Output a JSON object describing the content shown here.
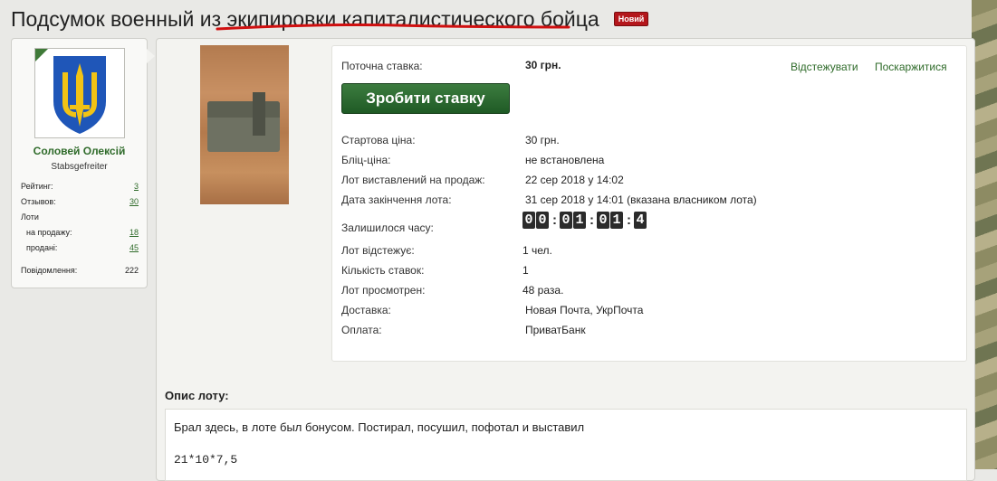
{
  "title": {
    "text": "Подсумок военный из экипировки капиталистического бойца",
    "badge": "Новий"
  },
  "user": {
    "name": "Соловей Олексій",
    "rank": "Stabsgefreiter",
    "stats": {
      "rating_label": "Рейтинг:",
      "rating_value": "3",
      "reviews_label": "Отзывов:",
      "reviews_value": "30",
      "lots_label": "Лоти",
      "for_sale_label": "на продажу:",
      "for_sale_value": "18",
      "sold_label": "продані:",
      "sold_value": "45",
      "messages_label": "Повідомлення:",
      "messages_value": "222"
    }
  },
  "lot": {
    "current_bid_label": "Поточна ставка:",
    "current_bid_value": "30 грн.",
    "watch_link": "Відстежувати",
    "report_link": "Поскаржитися",
    "bid_button": "Зробити ставку",
    "rows": [
      {
        "label": "Стартова ціна:",
        "value": "30 грн."
      },
      {
        "label": "Бліц-ціна:",
        "value": "не встановлена"
      },
      {
        "label": "Лот виставлений на продаж:",
        "value": "22 сер 2018 у 14:02"
      },
      {
        "label": "Дата закінчення лота:",
        "value": "31 сер 2018 у 14:01 (вказана власником лота)"
      }
    ],
    "time_left_label": "Залишилося часу:",
    "timer": [
      "0",
      "0",
      "0",
      "1",
      "0",
      "1",
      "4"
    ],
    "rows2": [
      {
        "label": "Лот відстежує:",
        "value": "1 чел."
      },
      {
        "label": "Кількість ставок:",
        "value": "1"
      },
      {
        "label": "Лот просмотрен:",
        "value": "48 раза."
      },
      {
        "label": "Доставка:",
        "value": "Новая Почта, УкрПочта"
      },
      {
        "label": "Оплата:",
        "value": "ПриватБанк"
      }
    ]
  },
  "description": {
    "title": "Опис лоту:",
    "line1": "Брал здесь, в лоте был бонусом. Постирал, посушил, пофотал и выставил",
    "line2": "21*10*7,5"
  },
  "colors": {
    "accent_green": "#2f6b2a",
    "button_green": "#2b6b2f",
    "badge_red": "#b4161b"
  }
}
